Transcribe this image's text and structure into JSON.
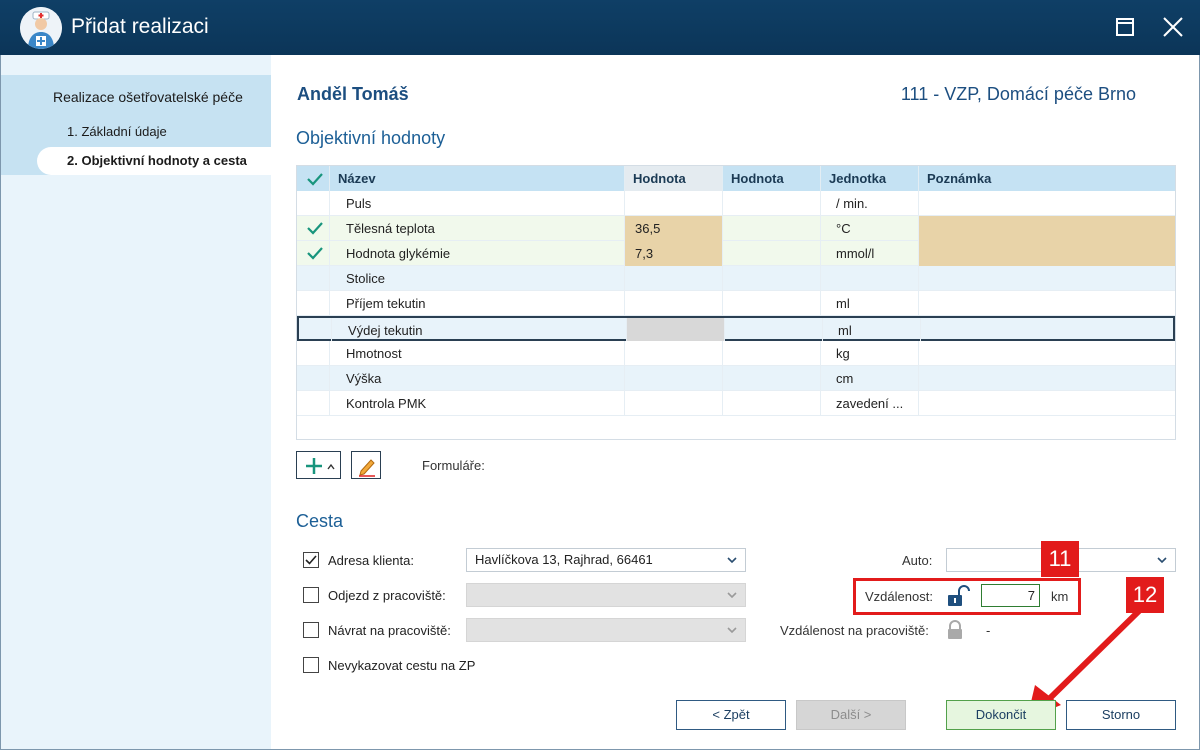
{
  "window": {
    "title": "Přidat realizaci"
  },
  "sidebar": {
    "title": "Realizace ošetřovatelské péče",
    "steps": [
      {
        "label": "1. Základní údaje"
      },
      {
        "label": "2. Objektivní hodnoty a cesta"
      }
    ]
  },
  "header": {
    "patient": "Anděl Tomáš",
    "insurance": "111 - VZP, Domácí péče Brno"
  },
  "objective": {
    "section_title": "Objektivní hodnoty",
    "columns": [
      "Název",
      "Hodnota",
      "Hodnota",
      "Jednotka",
      "Poznámka"
    ],
    "rows": [
      {
        "checked": false,
        "name": "Puls",
        "value1": "",
        "value2": "",
        "unit": "/ min.",
        "note": ""
      },
      {
        "checked": true,
        "name": "Tělesná teplota",
        "value1": "36,5",
        "value2": "",
        "unit": "°C",
        "note": ""
      },
      {
        "checked": true,
        "name": "Hodnota glykémie",
        "value1": "7,3",
        "value2": "",
        "unit": "mmol/l",
        "note": ""
      },
      {
        "checked": false,
        "name": "Stolice",
        "value1": "",
        "value2": "",
        "unit": "",
        "note": ""
      },
      {
        "checked": false,
        "name": "Příjem tekutin",
        "value1": "",
        "value2": "",
        "unit": "ml",
        "note": ""
      },
      {
        "checked": false,
        "name": "Výdej tekutin",
        "value1": "",
        "value2": "",
        "unit": "ml",
        "note": ""
      },
      {
        "checked": false,
        "name": "Hmotnost",
        "value1": "",
        "value2": "",
        "unit": "kg",
        "note": ""
      },
      {
        "checked": false,
        "name": "Výška",
        "value1": "",
        "value2": "",
        "unit": "cm",
        "note": ""
      },
      {
        "checked": false,
        "name": "Kontrola PMK",
        "value1": "",
        "value2": "",
        "unit": "zavedení ...",
        "note": ""
      }
    ],
    "forms_label": "Formuláře:"
  },
  "route": {
    "section_title": "Cesta",
    "client_address": {
      "label": "Adresa klienta:",
      "checked": true,
      "value": "Havlíčkova 13, Rajhrad, 66461"
    },
    "departure": {
      "label": "Odjezd z pracoviště:",
      "checked": false,
      "value": ""
    },
    "return": {
      "label": "Návrat na pracoviště:",
      "checked": false,
      "value": ""
    },
    "no_report": {
      "label": "Nevykazovat cestu na ZP",
      "checked": false
    },
    "car_label": "Auto:",
    "car_value": "",
    "distance_label": "Vzdálenost:",
    "distance_value": "7",
    "distance_unit": "km",
    "workplace_distance_label": "Vzdálenost na pracoviště:",
    "workplace_distance_value": "-"
  },
  "annotations": {
    "badge_11": "11",
    "badge_12": "12"
  },
  "buttons": {
    "back": "< Zpět",
    "next": "Další >",
    "finish": "Dokončit",
    "cancel": "Storno"
  },
  "colors": {
    "titlebar": "#0f3f66",
    "accent": "#1c5f96",
    "check": "#18957d",
    "annotation": "#e21b1b",
    "filled_cell": "#e8d3a8"
  }
}
